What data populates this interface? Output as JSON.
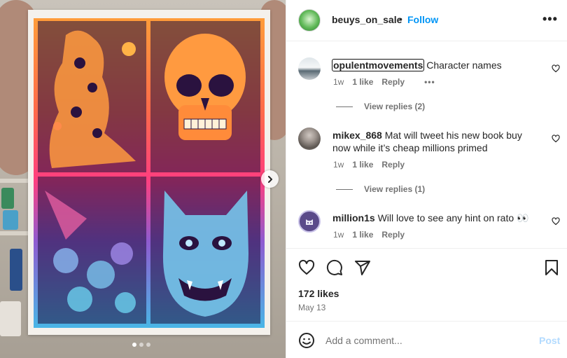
{
  "post": {
    "carousel": {
      "current": 1,
      "total": 3
    },
    "header": {
      "username": "beuys_on_sale",
      "separator": "•",
      "follow_label": "Follow",
      "more_label": "•••"
    },
    "comments": [
      {
        "username": "opulentmovements",
        "text": "Character names",
        "time": "1w",
        "likes": "1 like",
        "reply_label": "Reply",
        "more_label": "•••",
        "view_replies": "View replies (2)"
      },
      {
        "username": "mikex_868",
        "text": "Mat will tweet his new book buy now while it’s cheap millions primed",
        "time": "1w",
        "likes": "1 like",
        "reply_label": "Reply",
        "view_replies": "View replies (1)"
      },
      {
        "username": "million1s",
        "text": "Will love to see any hint on rato 👀",
        "time": "1w",
        "likes": "1 like",
        "reply_label": "Reply"
      }
    ],
    "likes_count": "172 likes",
    "date": "May 13",
    "add_comment": {
      "placeholder": "Add a comment...",
      "post_label": "Post"
    },
    "icons": [
      "heart-icon",
      "comment-icon",
      "share-icon",
      "bookmark-icon",
      "emoji-icon",
      "chevron-right-icon"
    ],
    "colors": {
      "accent": "#0095f6",
      "post_disabled": "#b3dbff",
      "muted": "#737373",
      "text": "#262626"
    }
  }
}
